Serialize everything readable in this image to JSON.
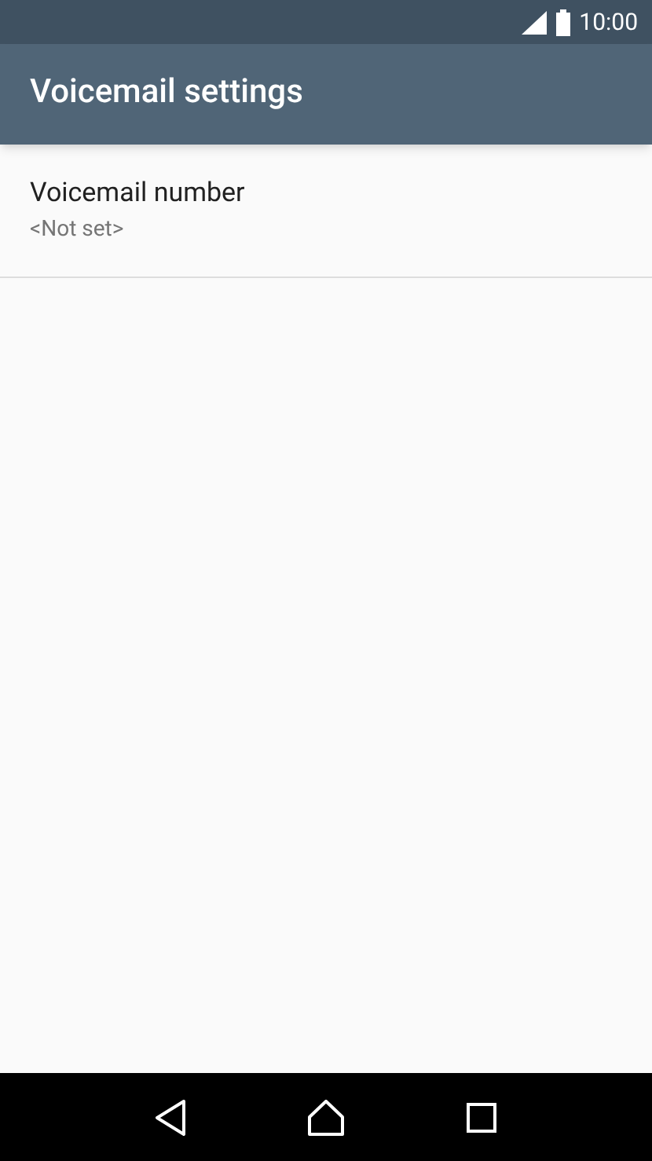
{
  "status_bar": {
    "time": "10:00"
  },
  "app_bar": {
    "title": "Voicemail settings"
  },
  "settings": [
    {
      "title": "Voicemail number",
      "summary": "<Not set>"
    }
  ]
}
